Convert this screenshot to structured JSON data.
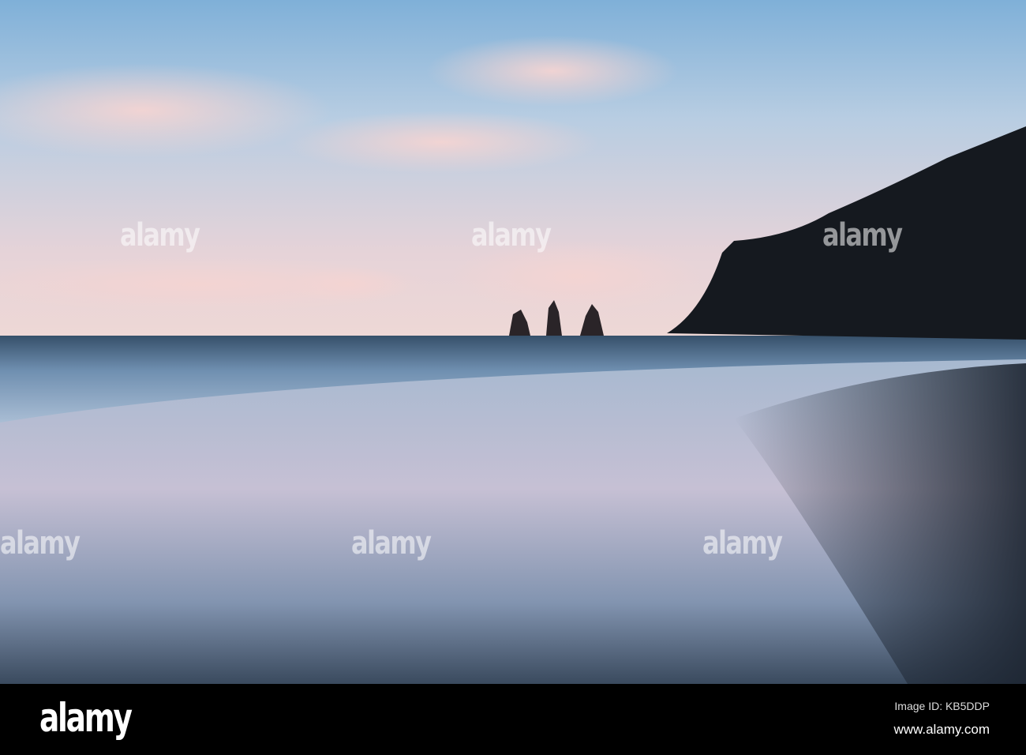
{
  "watermark": "alamy",
  "footer": {
    "logo": "alamy",
    "image_id": "Image ID: KB5DDP",
    "url": "www.alamy.com"
  }
}
